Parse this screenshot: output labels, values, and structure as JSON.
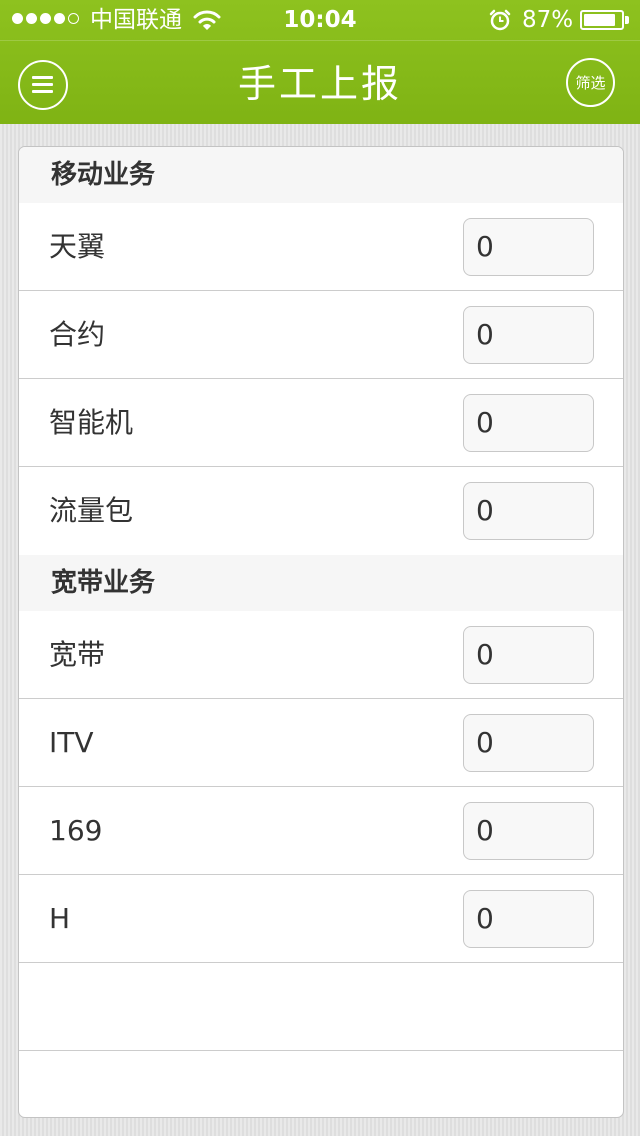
{
  "status_bar": {
    "carrier": "中国联通",
    "time": "10:04",
    "battery_percent": "87%",
    "battery_level": 0.87,
    "signal_bars": 4,
    "signal_total": 5
  },
  "header": {
    "title": "手工上报",
    "menu_icon": "hamburger-menu-icon",
    "filter_label": "筛选"
  },
  "colors": {
    "header_green": "#84b818",
    "text": "#333333"
  },
  "sections": [
    {
      "title": "移动业务",
      "rows": [
        {
          "label": "天翼",
          "value": "0"
        },
        {
          "label": "合约",
          "value": "0"
        },
        {
          "label": "智能机",
          "value": "0"
        },
        {
          "label": "流量包",
          "value": "0"
        }
      ]
    },
    {
      "title": "宽带业务",
      "rows": [
        {
          "label": "宽带",
          "value": "0"
        },
        {
          "label": "ITV",
          "value": "0"
        },
        {
          "label": "169",
          "value": "0"
        },
        {
          "label": "H",
          "value": "0"
        }
      ]
    }
  ]
}
